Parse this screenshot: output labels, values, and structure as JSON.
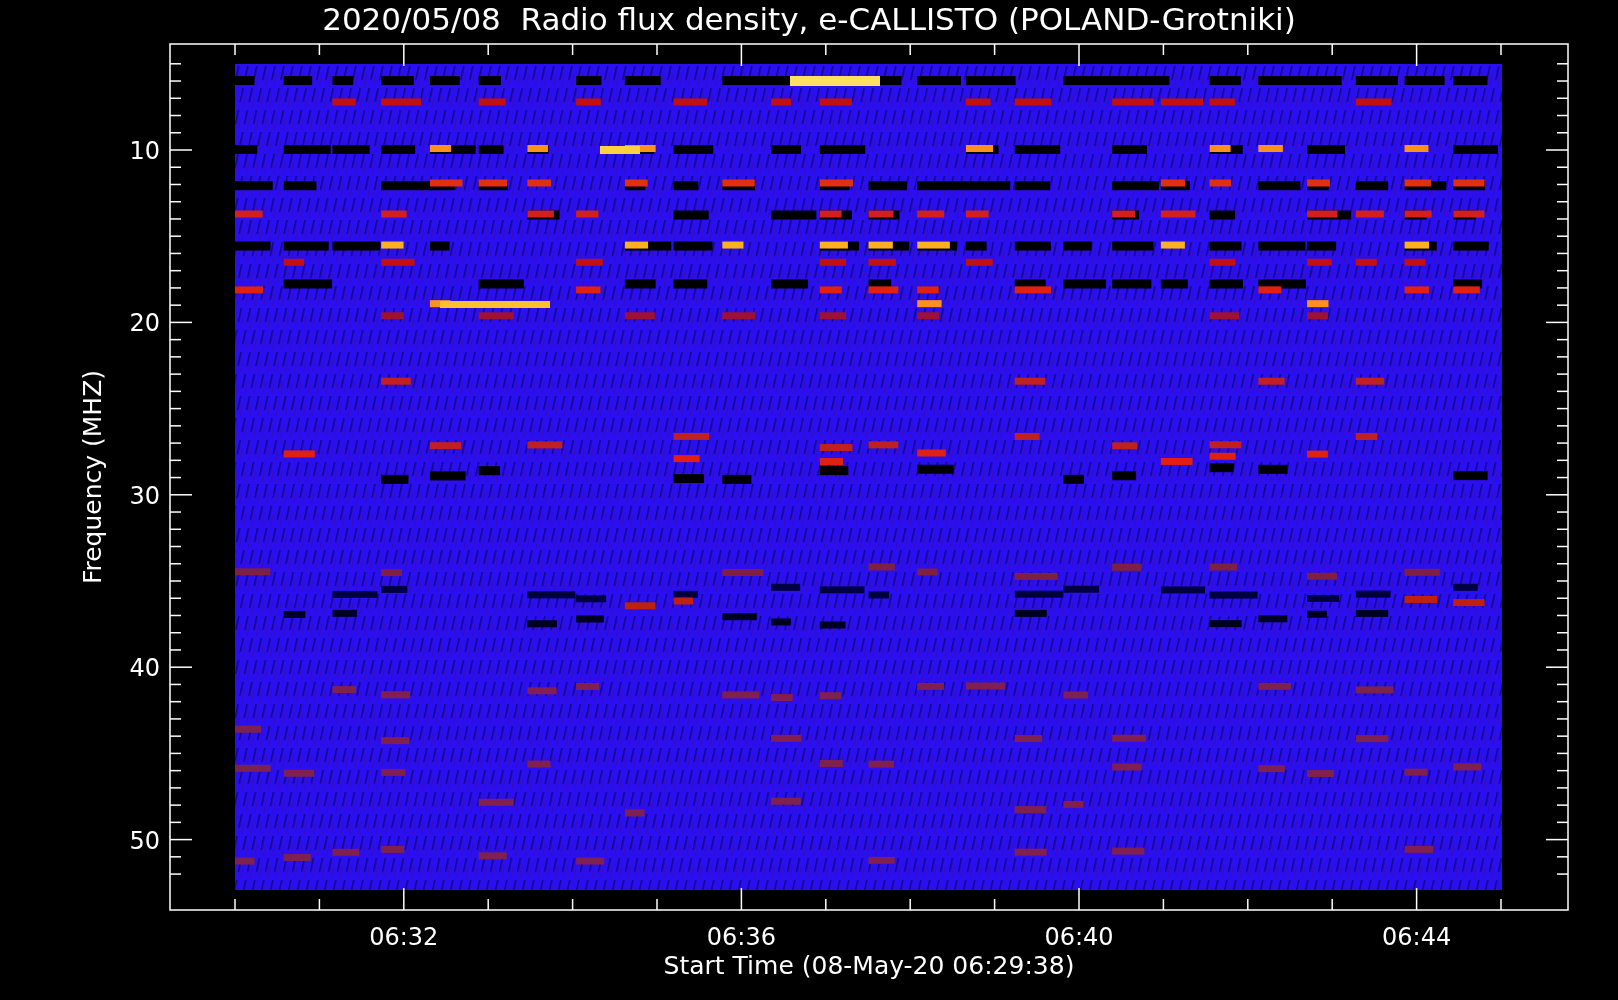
{
  "title": "2020/05/08  Radio flux density, e-CALLISTO (POLAND-Grotniki)",
  "y_axis": {
    "label": "Frequency (MHZ)",
    "ticks": [
      "10",
      "20",
      "30",
      "40",
      "50"
    ]
  },
  "x_axis": {
    "label": "Start Time (08-May-20 06:29:38)",
    "ticks": [
      "06:32",
      "06:36",
      "06:40",
      "06:44"
    ]
  }
}
